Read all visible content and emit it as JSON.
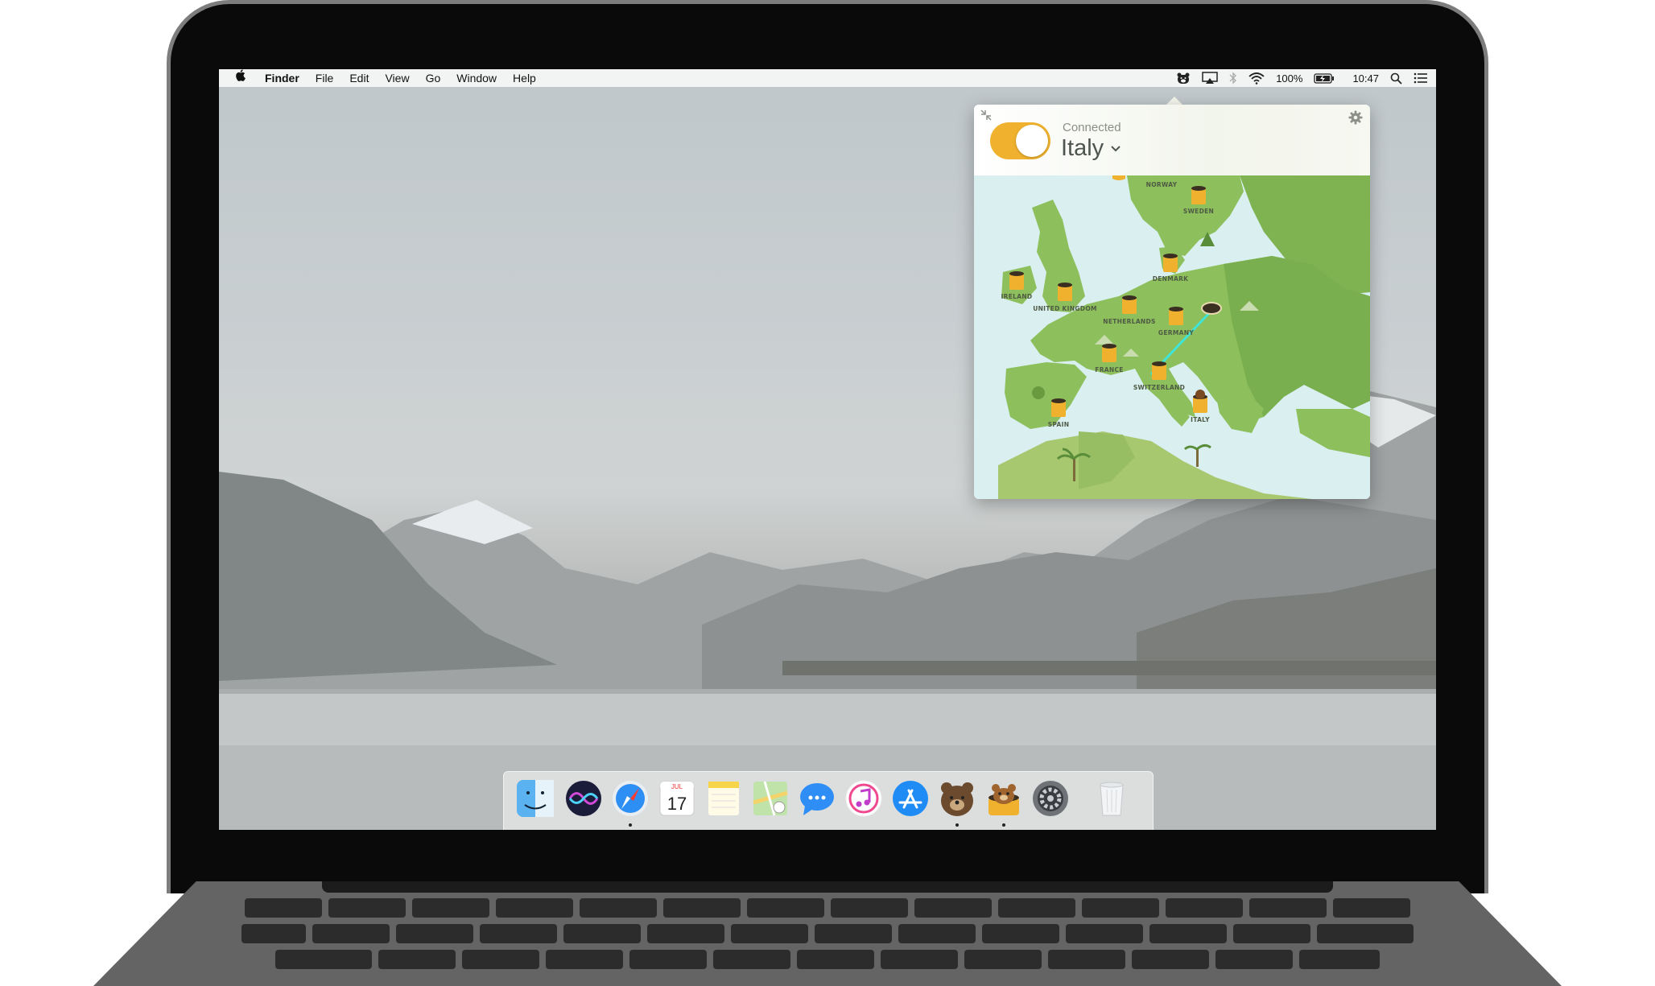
{
  "menubar": {
    "apple_symbol": "",
    "items": [
      "Finder",
      "File",
      "Edit",
      "View",
      "Go",
      "Window",
      "Help"
    ],
    "status": {
      "icons": [
        "tunnelbear-icon",
        "airplay-icon",
        "bluetooth-icon",
        "wifi-icon"
      ],
      "battery_percent": "100%",
      "time": "10:47",
      "extra_icons": [
        "spotlight-icon",
        "notification-center-icon"
      ]
    }
  },
  "tunnelbear": {
    "status": "Connected",
    "country": "Italy",
    "toggle_on": true,
    "accent_color": "#f0b22e",
    "map": {
      "locations": [
        "NORWAY",
        "SWEDEN",
        "DENMARK",
        "IRELAND",
        "UNITED KINGDOM",
        "NETHERLANDS",
        "GERMANY",
        "FRANCE",
        "SWITZERLAND",
        "ITALY",
        "SPAIN"
      ]
    }
  },
  "dock": {
    "apps": [
      "Finder",
      "Siri",
      "Safari",
      "Calendar",
      "Notes",
      "Maps",
      "Messages",
      "iTunes",
      "App Store",
      "RememBear",
      "TunnelBear",
      "System Preferences",
      "Trash"
    ],
    "calendar": {
      "month": "JUL",
      "day": "17"
    }
  }
}
